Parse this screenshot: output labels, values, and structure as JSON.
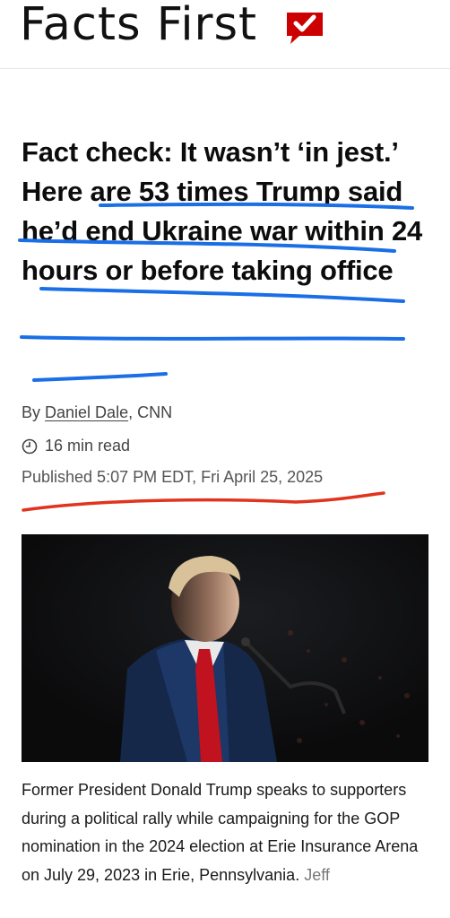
{
  "brand": {
    "name": "Facts First"
  },
  "article": {
    "headline_part1": "Fact check: It wasn’t ‘in jest.’",
    "headline_part2": "Here are 53 times Trump said he’d end Ukraine war within 24 hours or before taking office",
    "byline_prefix": "By",
    "author": "Daniel Dale",
    "outlet": ", CNN",
    "read_time": "16 min read",
    "published": "Published 5:07 PM EDT, Fri April 25, 2025"
  },
  "image": {
    "caption": "Former President Donald Trump speaks to supporters during a political rally while campaigning for the GOP nomination in the 2024 election at Erie Insurance Arena on July 29, 2023 in Erie, Pennsylvania.",
    "credit": "Jeff"
  },
  "icons": {
    "brand": "check-badge-icon",
    "time": "clock-icon"
  },
  "colors": {
    "brand_red": "#cc0000",
    "blue_ink": "#1a6ee6",
    "red_ink": "#e0341e"
  }
}
